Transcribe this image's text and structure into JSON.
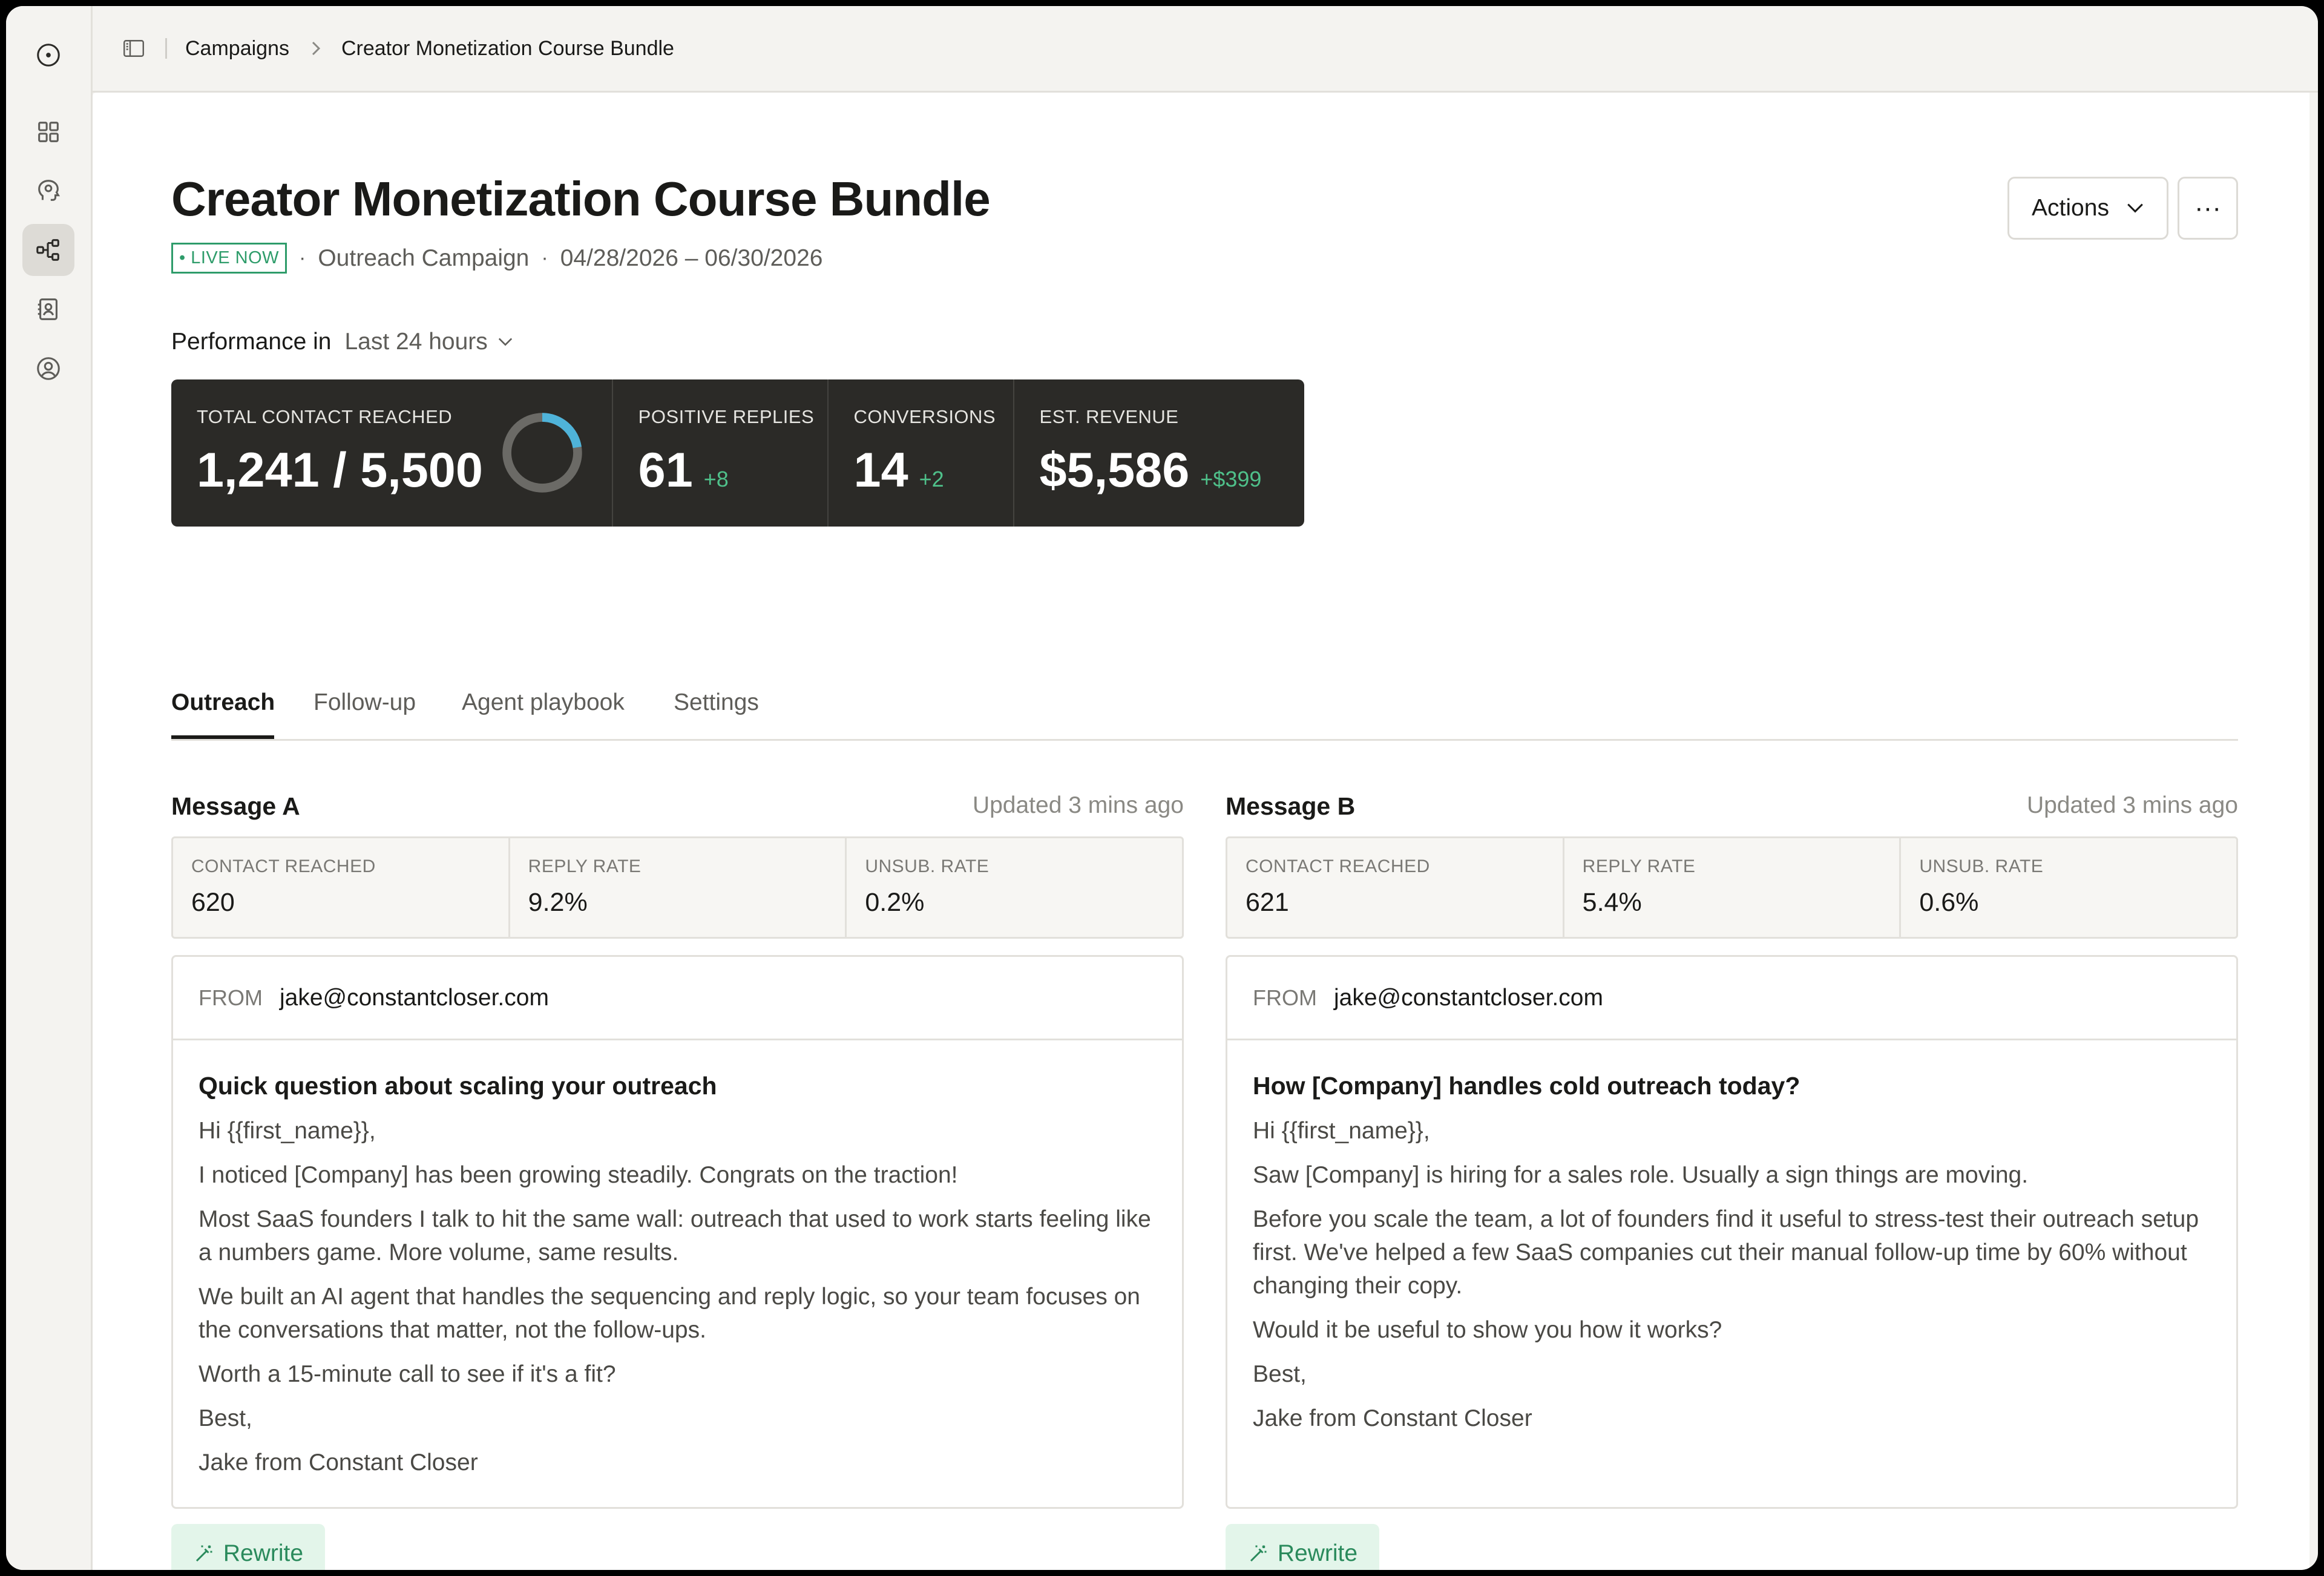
{
  "breadcrumb": {
    "parent": "Campaigns",
    "current": "Creator Monetization Course Bundle"
  },
  "rail": {
    "icons": [
      "logo-icon",
      "dashboard-icon",
      "agent-icon",
      "workflow-icon",
      "contacts-icon",
      "profile-icon"
    ],
    "active": "workflow-icon"
  },
  "header": {
    "title": "Creator Monetization Course Bundle",
    "status": "• LIVE NOW",
    "type": "Outreach Campaign",
    "dates": "04/28/2026 – 06/30/2026",
    "actions_label": "Actions",
    "more_label": "···"
  },
  "performance": {
    "label": "Performance in",
    "range": "Last 24 hours",
    "stats": {
      "reached": {
        "label": "TOTAL CONTACT REACHED",
        "value": "1,241 / 5,500",
        "progress": 0.2256
      },
      "positive": {
        "label": "POSITIVE REPLIES",
        "value": "61",
        "delta": "+8"
      },
      "conversions": {
        "label": "CONVERSIONS",
        "value": "14",
        "delta": "+2"
      },
      "revenue": {
        "label": "EST. REVENUE",
        "value": "$5,586",
        "delta": "+$399"
      }
    }
  },
  "tabs": [
    "Outreach",
    "Follow-up",
    "Agent playbook",
    "Settings"
  ],
  "active_tab": "Outreach",
  "messages": [
    {
      "title": "Message A",
      "updated": "Updated 3 mins ago",
      "stats": [
        {
          "label": "CONTACT REACHED",
          "value": "620"
        },
        {
          "label": "REPLY RATE",
          "value": "9.2%"
        },
        {
          "label": "UNSUB. RATE",
          "value": "0.2%"
        }
      ],
      "from_label": "FROM",
      "from": "jake@constantcloser.com",
      "subject": "Quick question about scaling your outreach",
      "body": [
        "Hi {{first_name}},",
        "I noticed [Company] has been growing steadily. Congrats on the traction!",
        "Most SaaS founders I talk to hit the same wall: outreach that used to work starts feeling like a numbers game. More volume, same results.",
        "We built an AI agent that handles the sequencing and reply logic, so your team focuses on the conversations that matter, not the follow-ups.",
        "Worth a 15-minute call to see if it's a fit?",
        "Best,",
        "Jake from Constant Closer"
      ],
      "rewrite_label": "Rewrite"
    },
    {
      "title": "Message B",
      "updated": "Updated 3 mins ago",
      "stats": [
        {
          "label": "CONTACT REACHED",
          "value": "621"
        },
        {
          "label": "REPLY RATE",
          "value": "5.4%"
        },
        {
          "label": "UNSUB. RATE",
          "value": "0.6%"
        }
      ],
      "from_label": "FROM",
      "from": "jake@constantcloser.com",
      "subject": "How [Company] handles cold outreach today?",
      "body": [
        "Hi {{first_name}},",
        "Saw [Company] is hiring for a sales role. Usually a sign things are moving.",
        "Before you scale the team, a lot of founders find it useful to stress-test their outreach setup first. We've helped a few SaaS companies cut their manual follow-up time by 60% without changing their copy.",
        "Would it be useful to show you how it works?",
        "Best,",
        "Jake from Constant Closer"
      ],
      "rewrite_label": "Rewrite"
    }
  ],
  "colors": {
    "accent_green": "#2e9c6a",
    "delta_green": "#4fc08a",
    "donut_progress": "#4fb3d9",
    "dark_panel": "#2b2a27"
  }
}
